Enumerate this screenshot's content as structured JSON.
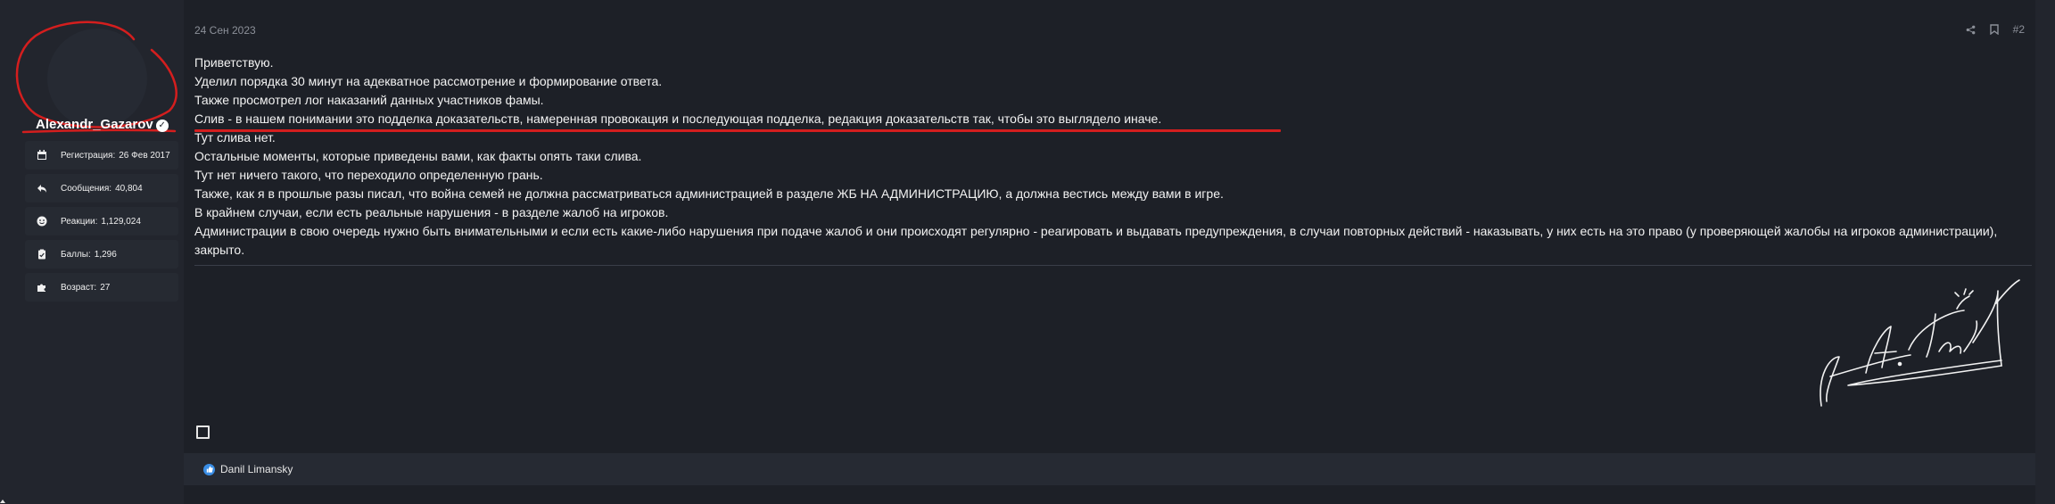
{
  "user": {
    "name": "Alexandr_Gazarov",
    "stats": [
      {
        "icon": "calendar-icon",
        "label": "Регистрация:",
        "value": "26 Фев 2017"
      },
      {
        "icon": "reply-icon",
        "label": "Сообщения:",
        "value": "40,804"
      },
      {
        "icon": "smile-icon",
        "label": "Реакции:",
        "value": "1,129,024"
      },
      {
        "icon": "clipboard-icon",
        "label": "Баллы:",
        "value": "1,296"
      },
      {
        "icon": "puzzle-icon",
        "label": "Возраст:",
        "value": "27"
      }
    ]
  },
  "post": {
    "date": "24 Сен 2023",
    "number": "#2",
    "lines": [
      "Приветствую.",
      "Уделил порядка 30 минут на адекватное рассмотрение и формирование ответа.",
      "Также просмотрел лог наказаний данных участников фамы.",
      "Слив - в нашем понимании это подделка доказательств, намеренная провокация и последующая подделка, редакция доказательств так, чтобы это выглядело иначе.",
      "Тут слива нет.",
      "Остальные моменты, которые приведены вами, как факты опять таки слива.",
      "Тут нет ничего такого, что переходило определенную грань.",
      "Также, как я в прошлые разы писал, что война семей не должна рассматриваться администрацией в разделе ЖБ НА АДМИНИСТРАЦИЮ, а должна вестись между вами в игре.",
      "В крайнем случаи, если есть реальные нарушения - в разделе жалоб на игроков.",
      "Администрации в свою очередь нужно быть внимательными и если есть какие-либо нарушения при подаче жалоб и они происходят регулярно - реагировать и выдавать предупреждения, в случаи повторных действий - наказывать, у них есть на это право (у проверяющей жалобы на игроков администрации), закрыто."
    ]
  },
  "reactions": {
    "icon": "thumbs-up-icon",
    "users": "Danil Limansky"
  },
  "colors": {
    "background": "#22252d",
    "content_bg": "#1d2027",
    "accent_red": "#d41e1e",
    "like_blue": "#3a8ee6"
  }
}
